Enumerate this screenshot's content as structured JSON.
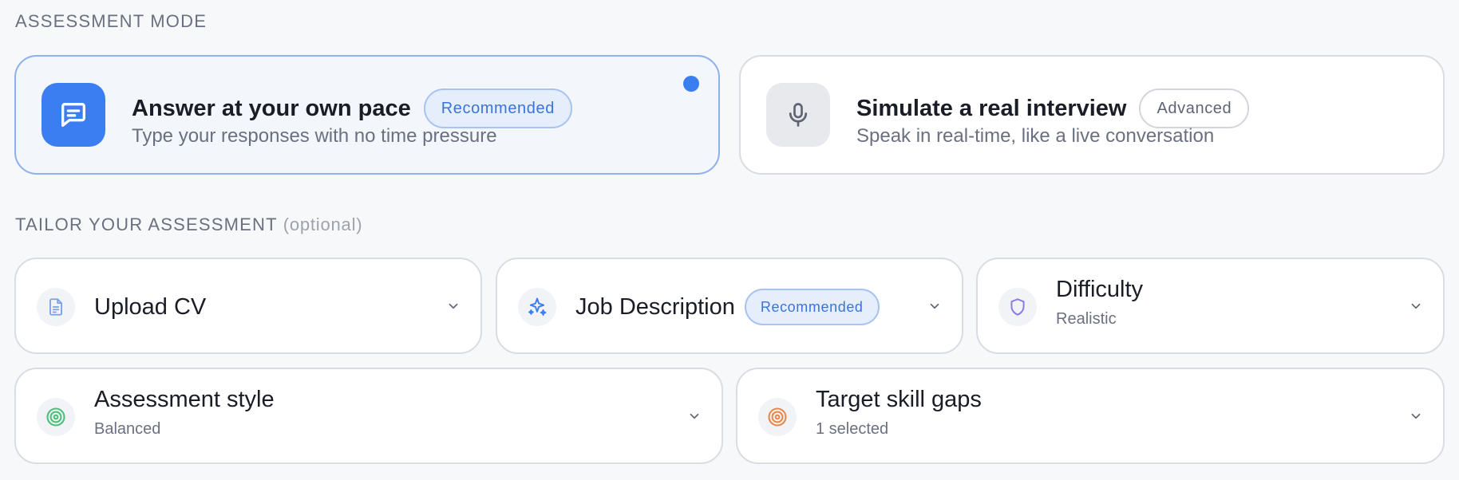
{
  "assessment_mode": {
    "label": "ASSESSMENT MODE",
    "options": [
      {
        "title": "Answer at your own pace",
        "badge": "Recommended",
        "subtitle": "Type your responses with no time pressure",
        "selected": true,
        "icon": "chat-message-icon"
      },
      {
        "title": "Simulate a real interview",
        "badge": "Advanced",
        "subtitle": "Speak in real-time, like a live conversation",
        "selected": false,
        "icon": "microphone-icon"
      }
    ]
  },
  "tailor": {
    "label": "TAILOR YOUR ASSESSMENT",
    "optional": "(optional)",
    "options": [
      {
        "title": "Upload CV",
        "icon": "document-icon"
      },
      {
        "title": "Job Description",
        "badge": "Recommended",
        "icon": "sparkle-icon"
      },
      {
        "title": "Difficulty",
        "value": "Realistic",
        "icon": "shield-icon"
      },
      {
        "title": "Assessment style",
        "value": "Balanced",
        "icon": "target-icon"
      },
      {
        "title": "Target skill gaps",
        "value": "1 selected",
        "icon": "target-icon"
      }
    ]
  },
  "colors": {
    "accent": "#3b7ef2",
    "selected_border": "#8cb1ee",
    "background": "#f7f8fa"
  }
}
